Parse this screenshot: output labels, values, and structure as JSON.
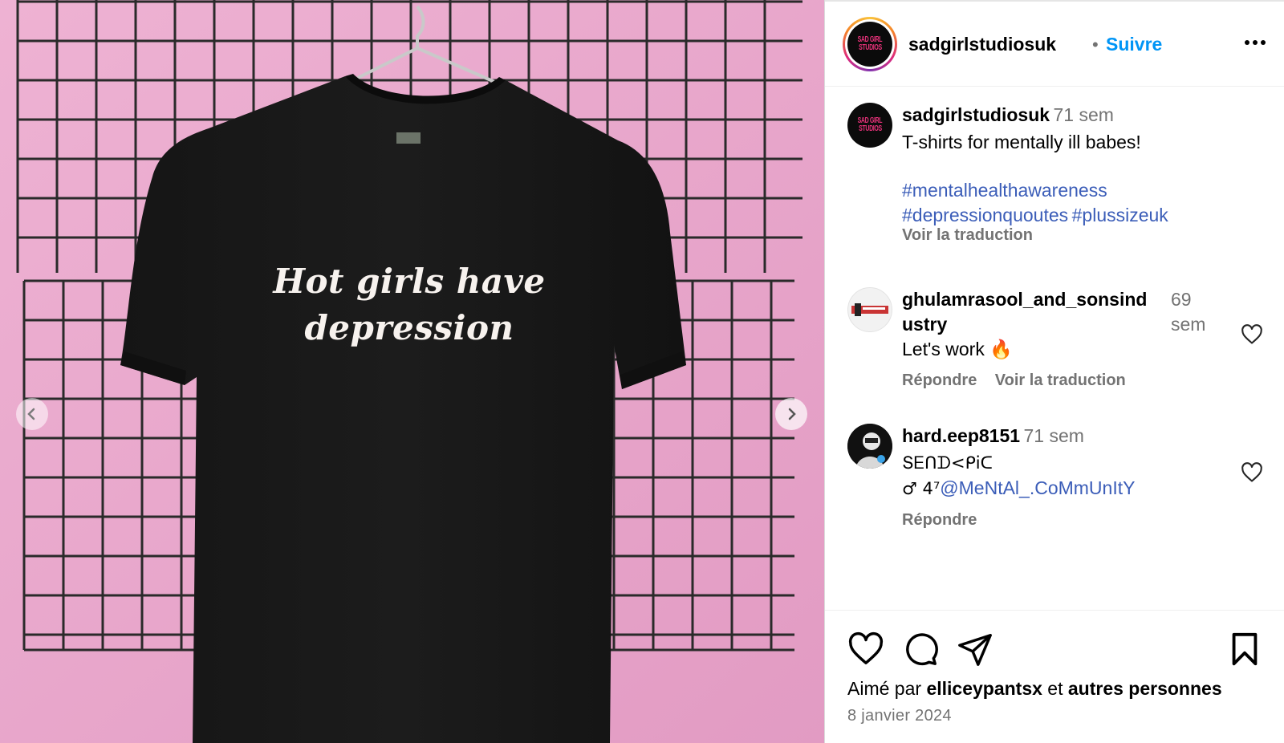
{
  "media": {
    "shirt_line1": "Hot girls have",
    "shirt_line2": "depression",
    "prev_icon": "chevron-left-icon",
    "next_icon": "chevron-right-icon"
  },
  "header": {
    "username": "sadgirlstudiosuk",
    "separator": "•",
    "follow_label": "Suivre",
    "more_icon": "more-horizontal-icon",
    "logo_text": [
      "SAD GIRL",
      "STUDIOS"
    ]
  },
  "caption": {
    "username": "sadgirlstudiosuk",
    "time": "71 sem",
    "text": "T-shirts for mentally ill babes!",
    "hashtags_line1": "#mentalhealthawareness",
    "hashtags_line2a": "#depressionquoutes",
    "hashtags_line2b": "#plussizeuk",
    "translate_label": "Voir la traduction"
  },
  "comments": [
    {
      "username_line1": "ghulamrasool_and_sonsind",
      "username_line2": "ustry",
      "time_line1": "69",
      "time_line2": "sem",
      "text": "Let's work 🔥",
      "reply_label": "Répondre",
      "translate_label": "Voir la traduction"
    },
    {
      "username": "hard.eep8151",
      "time": "71 sem",
      "text_line1": "ՏᎬᑎᗪ<ᑭiᑕ",
      "text_line2_prefix": "♂ 4⁷",
      "text_line2_mention": "@MeNtAl_.CoMmUnItY",
      "reply_label": "Répondre"
    }
  ],
  "footer": {
    "like_icon": "heart-icon",
    "comment_icon": "comment-icon",
    "share_icon": "send-icon",
    "save_icon": "bookmark-icon",
    "liked_prefix": "Aimé par",
    "liked_user": "elliceypantsx",
    "liked_middle": "et",
    "liked_others": "autres personnes",
    "date": "8 janvier 2024"
  },
  "colors": {
    "accent_blue": "#0095f6",
    "hashtag_blue": "#3b5db8",
    "muted": "#737373",
    "wall_pink": "#eaa6cc",
    "logo_pink": "#e8327a"
  }
}
